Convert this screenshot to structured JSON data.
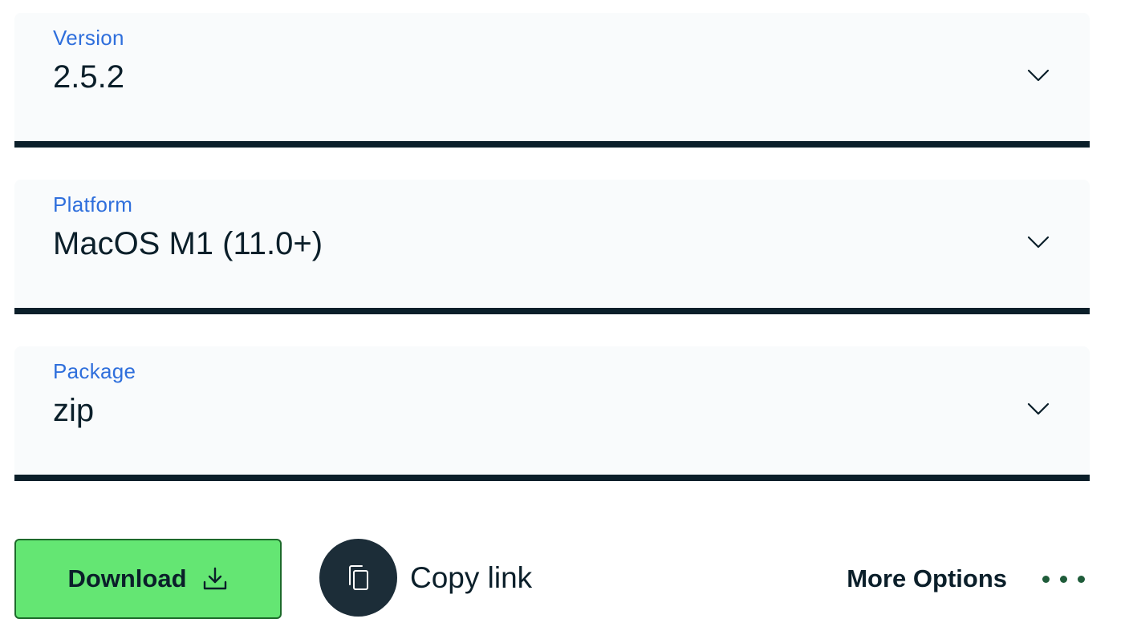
{
  "fields": [
    {
      "label": "Version",
      "value": "2.5.2"
    },
    {
      "label": "Platform",
      "value": "MacOS M1 (11.0+)"
    },
    {
      "label": "Package",
      "value": "zip"
    }
  ],
  "actions": {
    "download_label": "Download",
    "copy_link_label": "Copy link",
    "more_options_label": "More Options"
  },
  "icons": {
    "chevron": "chevron-down-icon",
    "download": "download-icon",
    "copy": "copy-icon",
    "more": "ellipsis-icon"
  },
  "colors": {
    "label_blue": "#2f6fdc",
    "text_dark": "#0b1f2a",
    "field_bg": "#f9fbfc",
    "download_green": "#64e673",
    "copy_circle": "#1c2d38"
  }
}
